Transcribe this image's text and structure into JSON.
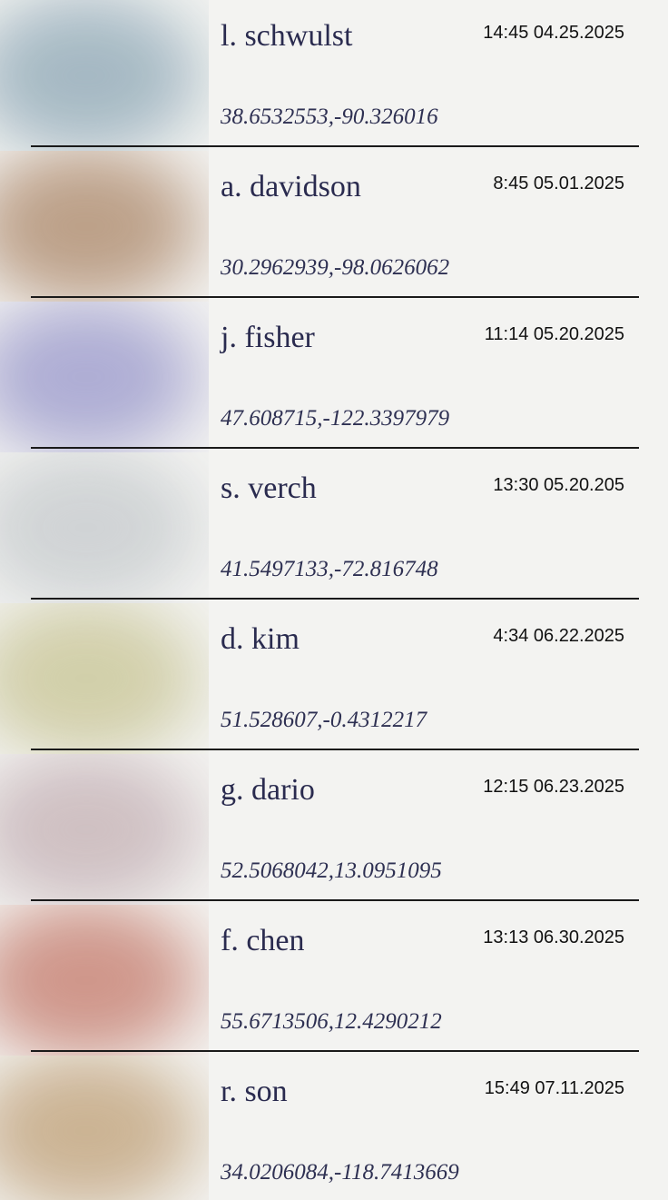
{
  "entries": [
    {
      "name": "l. schwulst",
      "time": "14:45 04.25.2025",
      "coords": "38.6532553,-90.326016",
      "photo_color": "#9fb4c0"
    },
    {
      "name": "a. davidson",
      "time": "8:45 05.01.2025",
      "coords": "30.2962939,-98.0626062",
      "photo_color": "#b89a80"
    },
    {
      "name": "j. fisher",
      "time": "11:14 05.20.2025",
      "coords": "47.608715,-122.3397979",
      "photo_color": "#a9a8d2"
    },
    {
      "name": "s. verch",
      "time": "13:30 05.20.205",
      "coords": "41.5497133,-72.816748",
      "photo_color": "#cdd1d3"
    },
    {
      "name": "d. kim",
      "time": "4:34 06.22.2025",
      "coords": "51.528607,-0.4312217",
      "photo_color": "#cfcca4"
    },
    {
      "name": "g. dario",
      "time": "12:15 06.23.2025",
      "coords": "52.5068042,13.0951095",
      "photo_color": "#ccbcbf"
    },
    {
      "name": "f. chen",
      "time": "13:13 06.30.2025",
      "coords": "55.6713506,12.4290212",
      "photo_color": "#cc8f82"
    },
    {
      "name": "r. son",
      "time": "15:49 07.11.2025",
      "coords": "34.0206084,-118.7413669",
      "photo_color": "#c8ae8c"
    }
  ]
}
